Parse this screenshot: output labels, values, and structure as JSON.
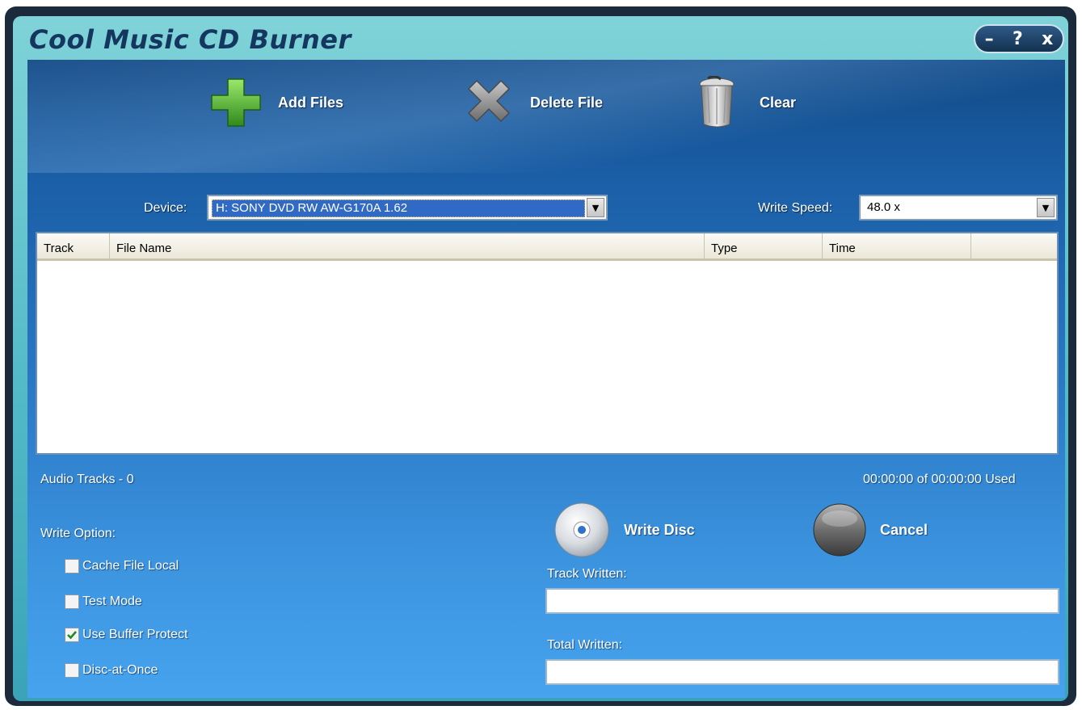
{
  "window": {
    "title": "Cool Music CD Burner",
    "controls": {
      "minimize": "–",
      "help": "?",
      "close": "x"
    }
  },
  "toolbar": {
    "add_files": "Add Files",
    "delete_file": "Delete File",
    "clear": "Clear"
  },
  "device": {
    "label": "Device:",
    "value": "H: SONY DVD RW AW-G170A 1.62"
  },
  "write_speed": {
    "label": "Write Speed:",
    "value": "48.0 x"
  },
  "tracks_table": {
    "columns": [
      "Track",
      "File Name",
      "Type",
      "Time"
    ],
    "rows": []
  },
  "status": {
    "audio_tracks": "Audio Tracks - 0",
    "used": "00:00:00 of 00:00:00 Used"
  },
  "write_options": {
    "label": "Write Option:",
    "items": [
      {
        "label": "Cache File Local",
        "checked": false
      },
      {
        "label": "Test Mode",
        "checked": false
      },
      {
        "label": "Use Buffer Protect",
        "checked": true
      },
      {
        "label": "Disc-at-Once",
        "checked": false
      }
    ]
  },
  "actions": {
    "write_disc": "Write Disc",
    "cancel": "Cancel"
  },
  "progress": {
    "track_written_label": "Track Written:",
    "total_written_label": "Total Written:",
    "track_written": 0,
    "total_written": 0
  },
  "colors": {
    "title_text": "#14365f",
    "client_top": "#124a86",
    "client_bottom": "#46a3ee",
    "selection": "#316ac5"
  }
}
